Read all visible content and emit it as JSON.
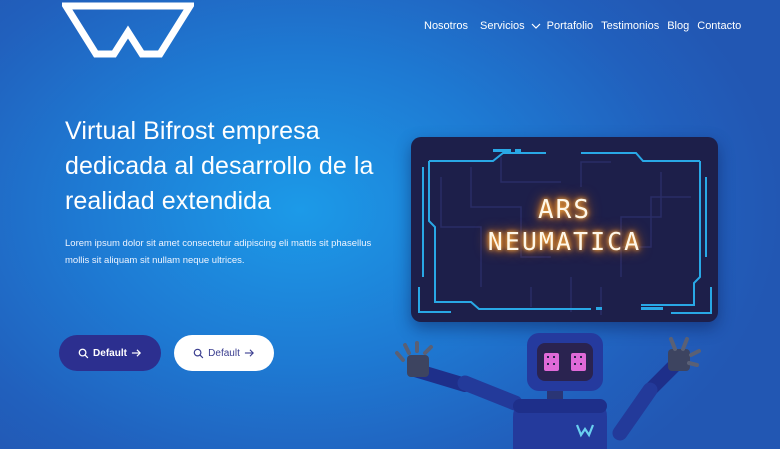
{
  "brand": {
    "logo_icon": "w-logo-icon"
  },
  "nav": {
    "items": [
      "Nosotros",
      "Servicios",
      "Portafolio",
      "Testimonios",
      "Blog",
      "Contacto"
    ],
    "dropdown_icon": "chevron-down-icon"
  },
  "hero": {
    "title": "Virtual Bifrost empresa dedicada al desarrollo de la realidad extendida",
    "description": "Lorem ipsum dolor sit amet consectetur adipiscing eli mattis sit phasellus mollis sit aliquam sit nullam neque ultrices.",
    "primary_button": {
      "label": "Default",
      "icon": "search-icon",
      "trailing_icon": "arrow-right-icon"
    },
    "secondary_button": {
      "label": "Default",
      "icon": "search-icon",
      "trailing_icon": "arrow-right-icon"
    }
  },
  "showcase": {
    "screen_line1": "ARS",
    "screen_line2": "NEUMATICA"
  },
  "colors": {
    "background": "#1e7ad3",
    "primary_button": "#2c2f8f",
    "secondary_button": "#ffffff",
    "screen_frame": "#29a8e6",
    "neon_text": "#ff8c1a"
  }
}
